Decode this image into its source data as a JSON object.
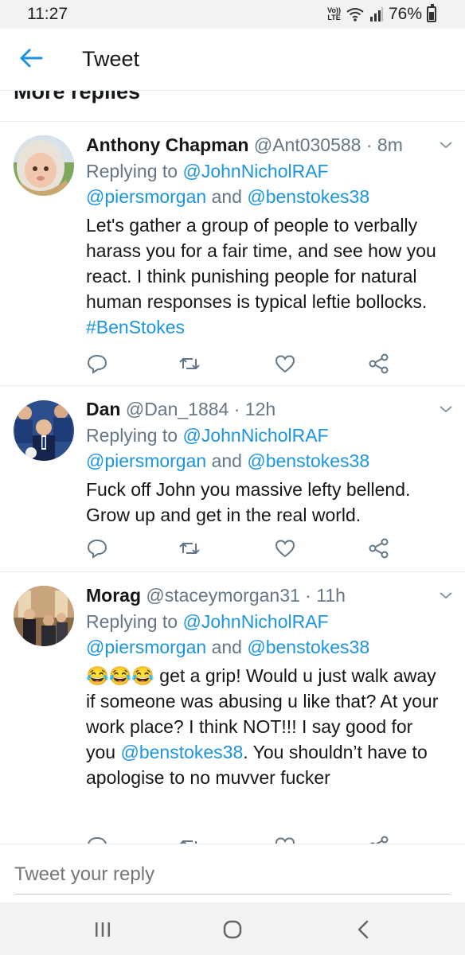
{
  "status_bar": {
    "time": "11:27",
    "volte_top": "Vo))",
    "volte_bottom": "LTE",
    "battery": "76%"
  },
  "header": {
    "title": "Tweet",
    "back_icon": "arrow-left-icon"
  },
  "section_title": "More replies",
  "tweets": [
    {
      "name": "Anthony Chapman",
      "handle": "@Ant030588",
      "time": "8m",
      "replying_prefix": "Replying to ",
      "reply_to_1": "@JohnNicholRAF",
      "reply_to_2": "@piersmorgan",
      "reply_and": " and ",
      "reply_to_3": "@benstokes38",
      "text_plain": "Let's gather a group of people to verbally harass you for a fair time, and see how you react. I think punishing people for natural human responses is typical leftie bollocks. ",
      "text_link": "#BenStokes"
    },
    {
      "name": "Dan",
      "handle": "@Dan_1884",
      "time": "12h",
      "replying_prefix": "Replying to ",
      "reply_to_1": "@JohnNicholRAF",
      "reply_to_2": "@piersmorgan",
      "reply_and": " and ",
      "reply_to_3": "@benstokes38",
      "text_plain": "Fuck off John you massive lefty bellend. Grow up and get in the real world."
    },
    {
      "name": "Morag",
      "handle": "@staceymorgan31",
      "time": "11h",
      "replying_prefix": "Replying to ",
      "reply_to_1": "@JohnNicholRAF",
      "reply_to_2": "@piersmorgan",
      "reply_and": " and ",
      "reply_to_3": "@benstokes38",
      "emoji": "😂😂😂",
      "text_a": " get a grip! Would u just walk away if someone was abusing u like that? At your work place? I think NOT!!! I say good for you ",
      "text_link": "@benstokes38",
      "text_b": ". You shouldn’t have to apologise to no muvver fucker"
    }
  ],
  "separator": " · ",
  "reply_placeholder": "Tweet your reply",
  "colors": {
    "accent": "#1b95e0",
    "text": "#14171a",
    "secondary": "#657786",
    "divider": "#e6ecf0"
  },
  "icons": [
    "reply-icon",
    "retweet-icon",
    "like-icon",
    "share-icon",
    "caret-down-icon"
  ],
  "nav": [
    "recent-apps-icon",
    "home-icon",
    "back-icon"
  ]
}
